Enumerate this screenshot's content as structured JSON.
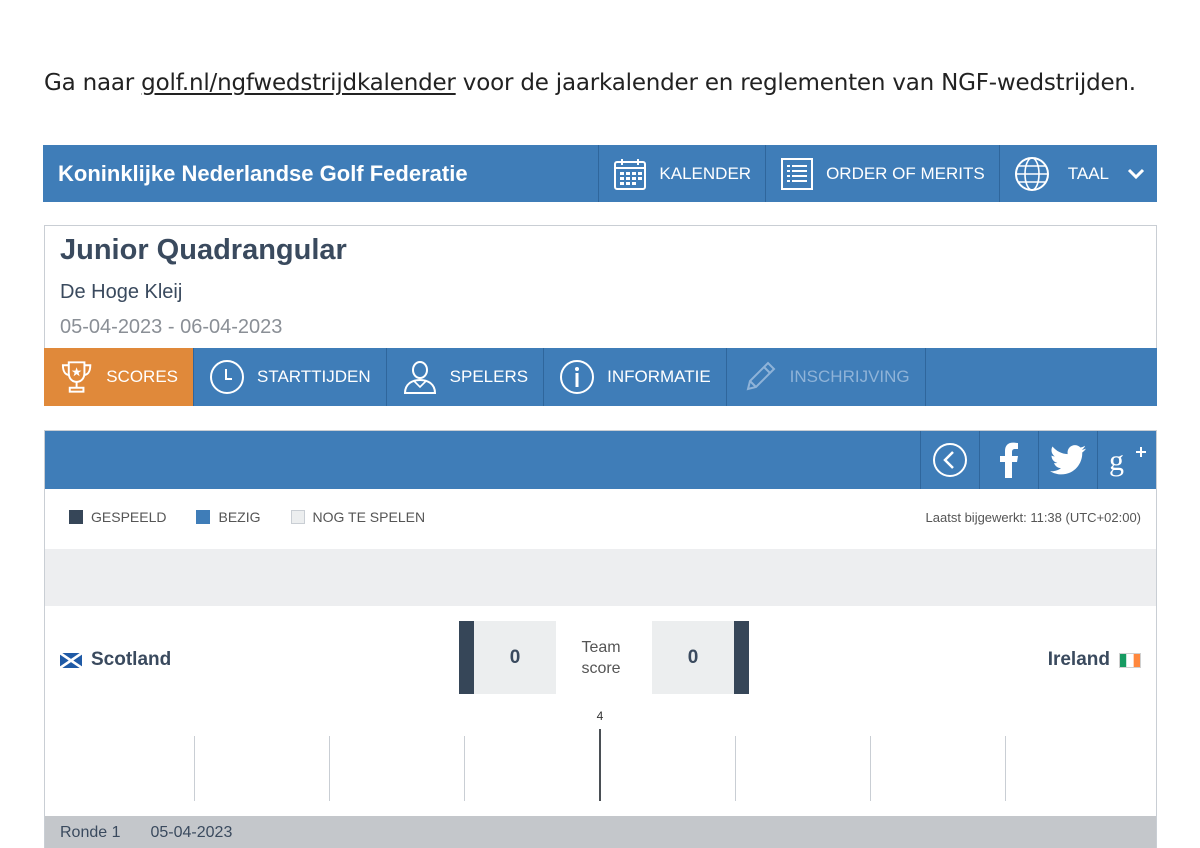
{
  "intro": {
    "prefix": "Ga naar ",
    "link": "golf.nl/ngfwedstrijdkalender",
    "suffix": " voor de jaarkalender en reglementen van NGF-wedstrijden."
  },
  "topbar": {
    "org": "Koninklijke Nederlandse Golf Federatie",
    "calendar": "KALENDER",
    "merits": "ORDER OF MERITS",
    "language": "TAAL"
  },
  "event": {
    "title": "Junior Quadrangular",
    "venue": "De Hoge Kleij",
    "dates": "05-04-2023 - 06-04-2023"
  },
  "tabs": [
    {
      "label": "SCORES"
    },
    {
      "label": "STARTTIJDEN"
    },
    {
      "label": "SPELERS"
    },
    {
      "label": "INFORMATIE"
    },
    {
      "label": "INSCHRIJVING"
    }
  ],
  "legend": {
    "played": "GESPEELD",
    "playing": "BEZIG",
    "to_play": "NOG TE SPELEN",
    "updated": "Laatst bijgewerkt: 11:38 (UTC+02:00)"
  },
  "match": {
    "home": "Scotland",
    "away": "Ireland",
    "home_score": "0",
    "away_score": "0",
    "team_score_line1": "Team",
    "team_score_line2": "score",
    "hole_marker": "4"
  },
  "round": {
    "label": "Ronde 1",
    "date": "05-04-2023"
  },
  "colors": {
    "primary": "#3f7db8",
    "active_tab": "#e0893a",
    "played": "#364658",
    "playing": "#3f7db8"
  }
}
